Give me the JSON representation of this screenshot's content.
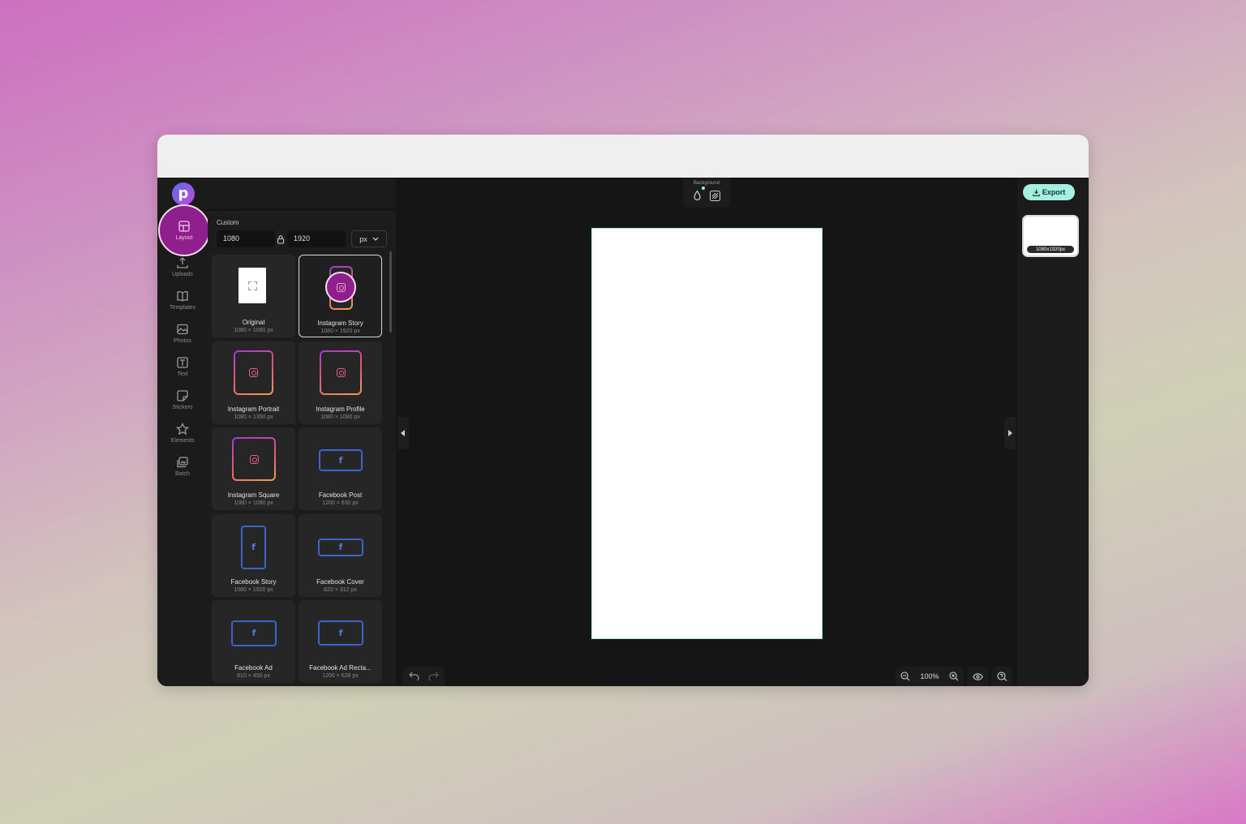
{
  "app": {
    "logo_letter": "p",
    "rail": [
      {
        "label": "Layout",
        "icon": "layout-icon",
        "active": true
      },
      {
        "label": "Uploads",
        "icon": "upload-icon"
      },
      {
        "label": "Templates",
        "icon": "book-icon"
      },
      {
        "label": "Photos",
        "icon": "image-icon"
      },
      {
        "label": "Text",
        "icon": "text-icon"
      },
      {
        "label": "Stickers",
        "icon": "sticker-icon"
      },
      {
        "label": "Elements",
        "icon": "star-icon"
      },
      {
        "label": "Batch",
        "icon": "batch-icon"
      }
    ]
  },
  "layout_panel": {
    "custom_label": "Custom",
    "width_value": "1080",
    "height_value": "1920",
    "unit": "px",
    "presets": [
      {
        "name": "Original",
        "size": "1080 × 1080 px",
        "kind": "original"
      },
      {
        "name": "Instagram Story",
        "size": "1080 × 1920 px",
        "kind": "instagram",
        "selected": true
      },
      {
        "name": "Instagram Portrait",
        "size": "1080 × 1350 px",
        "kind": "instagram"
      },
      {
        "name": "Instagram Profile",
        "size": "1080 × 1080 px",
        "kind": "instagram"
      },
      {
        "name": "Instagram Square",
        "size": "1080 × 1080 px",
        "kind": "instagram"
      },
      {
        "name": "Facebook Post",
        "size": "1200 × 630 px",
        "kind": "facebook"
      },
      {
        "name": "Facebook Story",
        "size": "1080 × 1920 px",
        "kind": "facebook"
      },
      {
        "name": "Facebook Cover",
        "size": "820 × 312 px",
        "kind": "facebook"
      },
      {
        "name": "Facebook Ad",
        "size": "810 × 450 px",
        "kind": "facebook"
      },
      {
        "name": "Facebook Ad Recta...",
        "size": "1200 × 628 px",
        "kind": "facebook"
      }
    ]
  },
  "canvas": {
    "background_label": "Background",
    "canvas_color": "#ffffff",
    "zoom": "100%"
  },
  "right_panel": {
    "export_label": "Export",
    "page_size_tag": "1080x1920px"
  },
  "colors": {
    "accent_highlight": "#8f1f8c",
    "export_button": "#a4efe1",
    "facebook_blue": "#3b63c9"
  }
}
